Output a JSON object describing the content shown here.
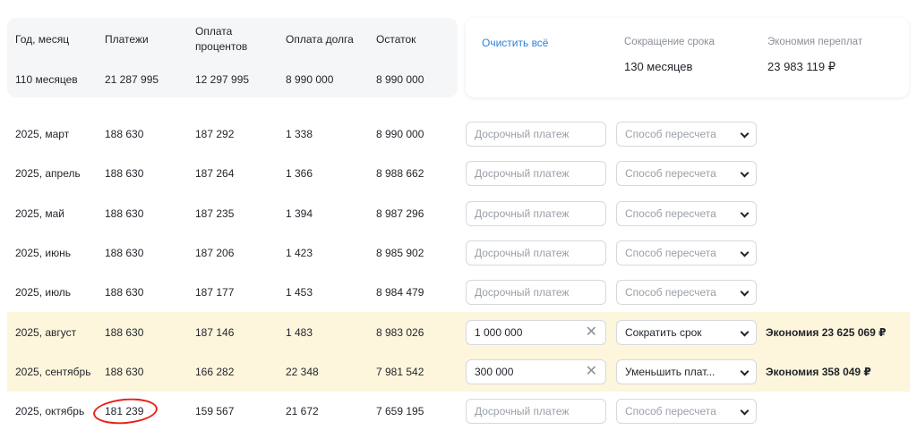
{
  "header": {
    "columns": [
      "Год, месяц",
      "Платежи",
      "Оплата\nпроцентов",
      "Оплата долга",
      "Остаток"
    ],
    "col_month": "Год, месяц",
    "col_payments": "Платежи",
    "col_interest_1": "Оплата",
    "col_interest_2": "процентов",
    "col_principal": "Оплата долга",
    "col_balance": "Остаток"
  },
  "totals": {
    "months": "110 месяцев",
    "payments": "21 287 995",
    "interest": "12 297 995",
    "principal": "8 990 000",
    "balance": "8 990 000"
  },
  "summary": {
    "clear_all": "Очистить всё",
    "term_reduction_label": "Сокращение срока",
    "term_reduction_value": "130 месяцев",
    "savings_label": "Экономия переплат",
    "savings_value": "23 983 119 ₽"
  },
  "placeholders": {
    "prepayment": "Досрочный платеж",
    "method": "Способ пересчета"
  },
  "rows": [
    {
      "month": "2025, март",
      "payment": "188 630",
      "interest": "187 292",
      "principal": "1 338",
      "balance": "8 990 000"
    },
    {
      "month": "2025, апрель",
      "payment": "188 630",
      "interest": "187 264",
      "principal": "1 366",
      "balance": "8 988 662"
    },
    {
      "month": "2025, май",
      "payment": "188 630",
      "interest": "187 235",
      "principal": "1 394",
      "balance": "8 987 296"
    },
    {
      "month": "2025, июнь",
      "payment": "188 630",
      "interest": "187 206",
      "principal": "1 423",
      "balance": "8 985 902"
    },
    {
      "month": "2025, июль",
      "payment": "188 630",
      "interest": "187 177",
      "principal": "1 453",
      "balance": "8 984 479"
    },
    {
      "month": "2025, август",
      "payment": "188 630",
      "interest": "187 146",
      "principal": "1 483",
      "balance": "8 983 026",
      "prepayment_value": "1 000 000",
      "method_value": "Сократить срок",
      "saving": "Экономия 23 625 069 ₽"
    },
    {
      "month": "2025, сентябрь",
      "payment": "188 630",
      "interest": "166 282",
      "principal": "22 348",
      "balance": "7 981 542",
      "prepayment_value": "300 000",
      "method_value": "Уменьшить плат...",
      "saving": "Экономия 358 049 ₽"
    },
    {
      "month": "2025, октябрь",
      "payment": "181 239",
      "interest": "159 567",
      "principal": "21 672",
      "balance": "7 659 195"
    }
  ],
  "colors": {
    "highlight_row": "#fdf5dc",
    "link": "#2f80d9",
    "annotation_circle": "#e8231a"
  },
  "icons": {
    "clear": "close-icon",
    "dropdown": "chevron-down-icon"
  }
}
